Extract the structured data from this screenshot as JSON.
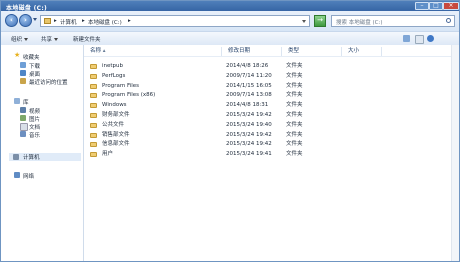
{
  "window": {
    "title": "本地磁盘 (C:)"
  },
  "address": {
    "crumbs": [
      "计算机",
      "本地磁盘 (C:)"
    ],
    "separator": "▸"
  },
  "search": {
    "placeholder": "搜索 本地磁盘 (C:)"
  },
  "toolbar": {
    "organize": "组织",
    "share": "共享",
    "new_folder": "新建文件夹"
  },
  "nav": {
    "favorites": "收藏夹",
    "fav_items": [
      "下载",
      "桌面",
      "最近访问的位置"
    ],
    "libraries": "库",
    "lib_items": [
      "视频",
      "图片",
      "文档",
      "音乐"
    ],
    "computer": "计算机",
    "network": "网络"
  },
  "columns": {
    "name": "名称",
    "date": "修改日期",
    "type": "类型",
    "size": "大小"
  },
  "files": [
    {
      "name": "inetpub",
      "date": "2014/4/8 18:26",
      "type": "文件夹"
    },
    {
      "name": "PerfLogs",
      "date": "2009/7/14 11:20",
      "type": "文件夹"
    },
    {
      "name": "Program Files",
      "date": "2014/1/15 16:05",
      "type": "文件夹"
    },
    {
      "name": "Program Files (x86)",
      "date": "2009/7/14 13:08",
      "type": "文件夹"
    },
    {
      "name": "Windows",
      "date": "2014/4/8 18:31",
      "type": "文件夹"
    },
    {
      "name": "财务部文件",
      "date": "2015/3/24 19:42",
      "type": "文件夹"
    },
    {
      "name": "公共文件",
      "date": "2015/3/24 19:40",
      "type": "文件夹"
    },
    {
      "name": "销售部文件",
      "date": "2015/3/24 19:42",
      "type": "文件夹"
    },
    {
      "name": "信息部文件",
      "date": "2015/3/24 19:42",
      "type": "文件夹"
    },
    {
      "name": "用户",
      "date": "2015/3/24 19:41",
      "type": "文件夹"
    }
  ],
  "colors": {
    "title_bar": "#3f6fae",
    "folder": "#efcc72",
    "selection": "#e0ebf8"
  }
}
